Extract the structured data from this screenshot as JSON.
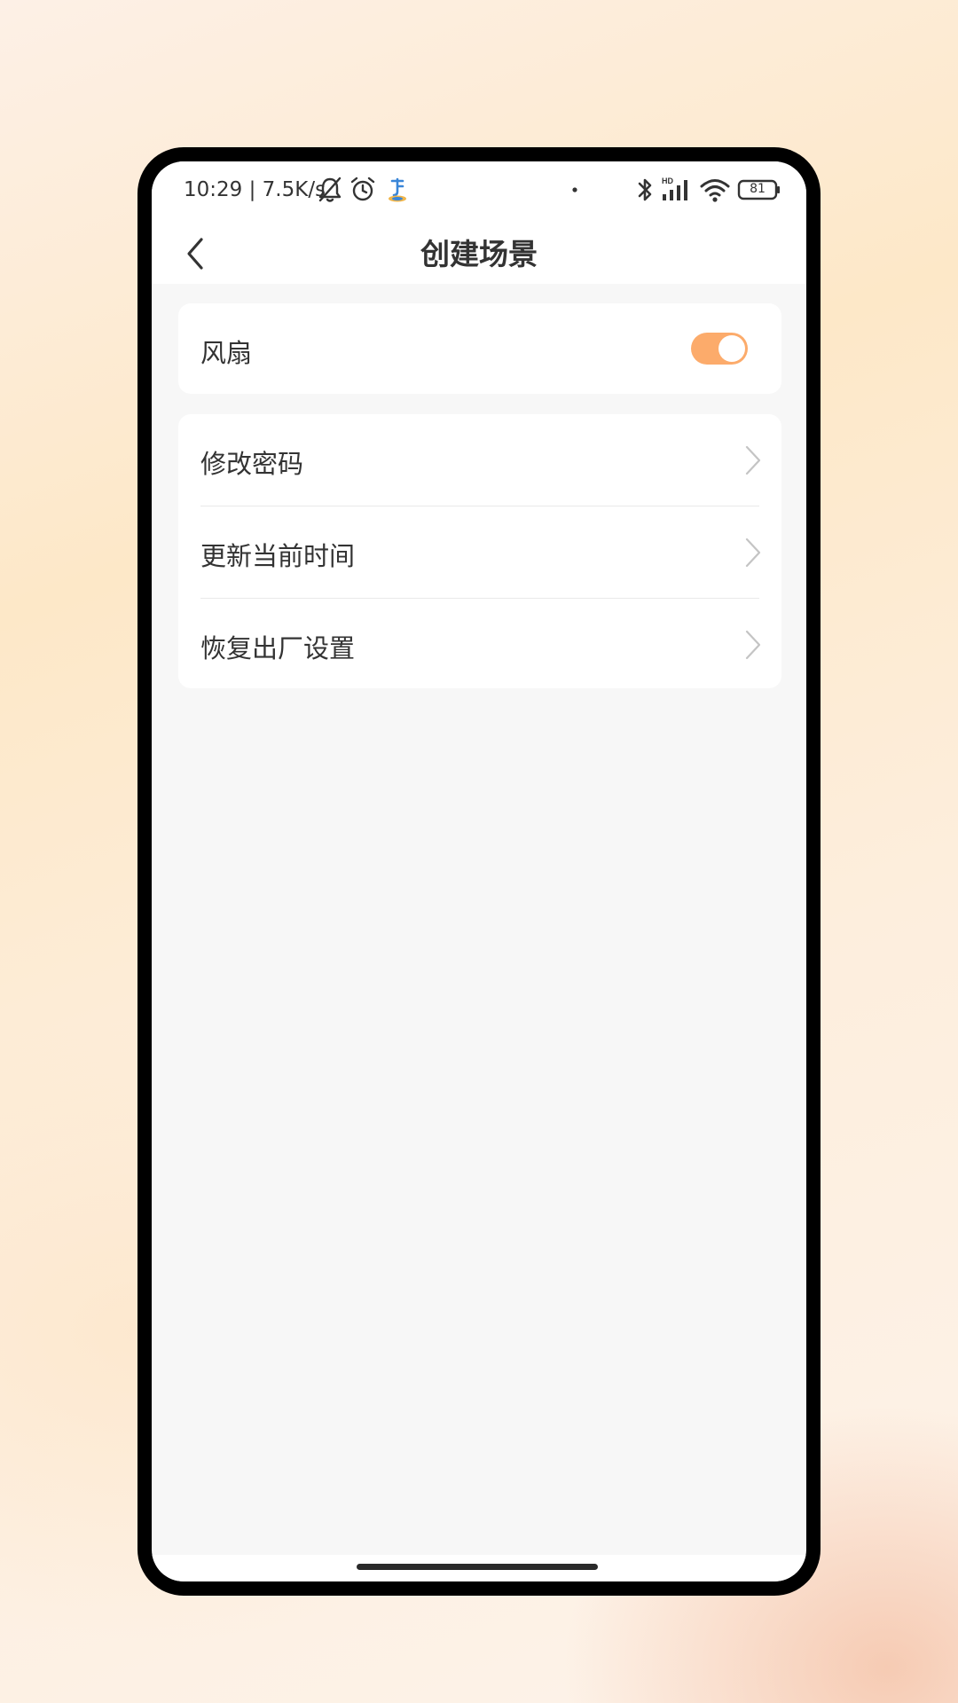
{
  "status_bar": {
    "time_and_speed": "10:29 | 7.5K/s",
    "battery_level": "81",
    "icons": [
      "bell-off-icon",
      "alarm-clock-icon",
      "app-notification-icon",
      "dot-icon",
      "bluetooth-icon",
      "hd-signal-icon",
      "wifi-icon",
      "battery-icon"
    ]
  },
  "header": {
    "title": "创建场景",
    "back_icon": "chevron-left-icon"
  },
  "fan_card": {
    "label": "风扇",
    "toggle_on": true,
    "toggle_color": "#fcab6b"
  },
  "settings": {
    "items": [
      {
        "label": "修改密码"
      },
      {
        "label": "更新当前时间"
      },
      {
        "label": "恢复出厂设置"
      }
    ],
    "chevron_icon": "chevron-right-icon"
  },
  "colors": {
    "accent": "#fcab6b",
    "background": "#f7f7f7",
    "card": "#ffffff",
    "text": "#333333"
  }
}
